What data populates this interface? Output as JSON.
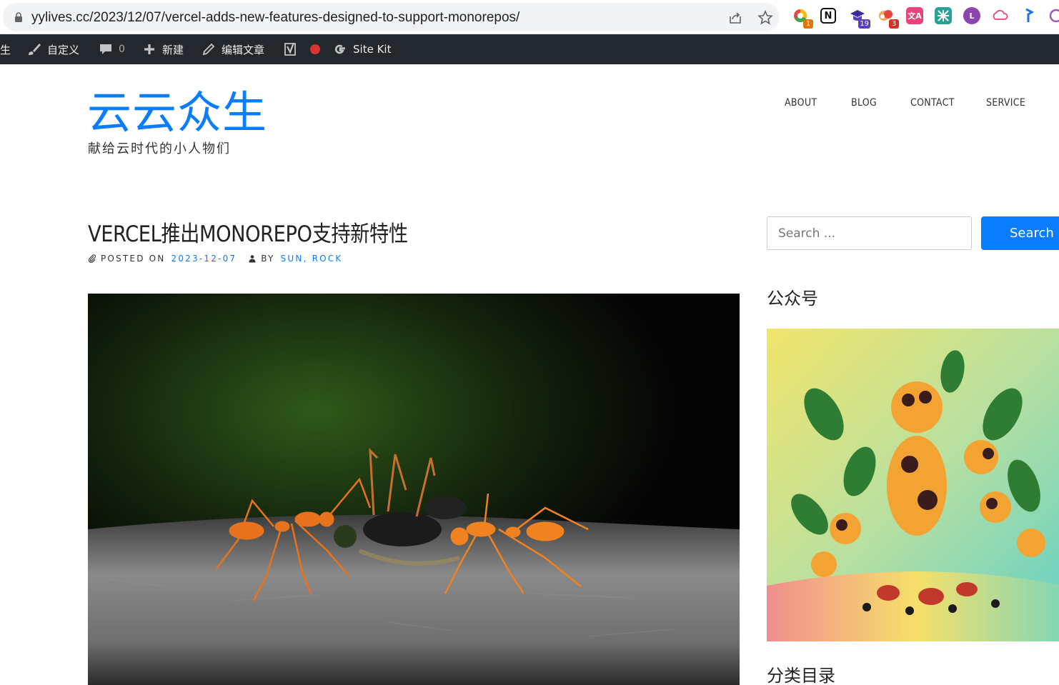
{
  "browser": {
    "url": "yylives.cc/2023/12/07/vercel-adds-new-features-designed-to-support-monorepos/",
    "extensions": [
      {
        "name": "colorful-circle-extension-icon",
        "badge": "1",
        "badge_color": "#e37400"
      },
      {
        "name": "notion-extension-icon",
        "badge": ""
      },
      {
        "name": "graduation-cap-extension-icon",
        "badge": "19",
        "badge_color": "#5b3cc4"
      },
      {
        "name": "orange-bubbles-extension-icon",
        "badge": "3",
        "badge_color": "#d93025"
      },
      {
        "name": "translate-extension-icon",
        "badge": ""
      },
      {
        "name": "teal-grid-extension-icon",
        "badge": ""
      },
      {
        "name": "purple-circle-extension-icon",
        "badge": ""
      },
      {
        "name": "cloud-extension-icon",
        "badge": ""
      },
      {
        "name": "blue-flag-extension-icon",
        "badge": ""
      },
      {
        "name": "openai-extension-icon",
        "badge": ""
      }
    ]
  },
  "admin_bar": {
    "site_fragment": "生",
    "customize": "自定义",
    "comments_count": "0",
    "new": "新建",
    "edit_post": "编辑文章",
    "site_kit": "Site Kit"
  },
  "site": {
    "title": "云云众生",
    "description": "献给云时代的小人物们",
    "accent_color": "#0a7cff"
  },
  "nav": {
    "items": [
      "ABOUT",
      "BLOG",
      "CONTACT",
      "SERVICE"
    ]
  },
  "post": {
    "title": "VERCEL推出MONOREPO支持新特性",
    "posted_on_label": "POSTED ON",
    "date": "2023-12-07",
    "by_label": "BY",
    "authors": "SUN, ROCK"
  },
  "sidebar": {
    "search_placeholder": "Search ...",
    "search_button": "Search",
    "widget_wechat_title": "公众号",
    "widget_categories_title": "分类目录"
  }
}
